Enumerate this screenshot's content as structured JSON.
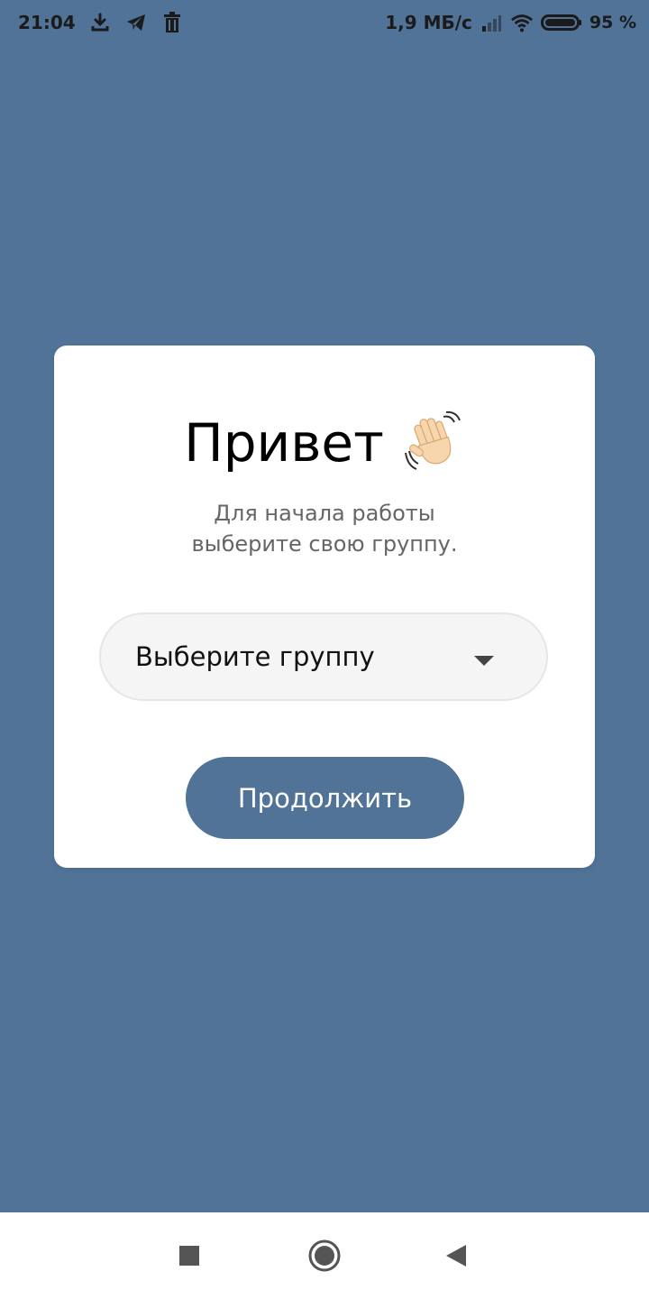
{
  "status_bar": {
    "time": "21:04",
    "net_speed": "1,9 МБ/с",
    "battery": "95 %",
    "icons": [
      "download-icon",
      "telegram-icon",
      "trash-icon",
      "signal-icon",
      "wifi-icon",
      "battery-icon"
    ]
  },
  "card": {
    "title": "Привет",
    "title_emoji_icon": "waving-hand-icon",
    "subtitle_line1": "Для начала работы",
    "subtitle_line2": "выберите свою группу."
  },
  "group_select": {
    "value": "Выберите группу",
    "icon": "chevron-down-icon"
  },
  "continue_button": {
    "label": "Продолжить"
  },
  "nav_bar": {
    "icons": [
      "recents-icon",
      "home-icon",
      "back-icon"
    ]
  },
  "colors": {
    "background": "#507397",
    "card": "#ffffff",
    "accent": "#507397",
    "select_bg": "#f5f5f5"
  }
}
